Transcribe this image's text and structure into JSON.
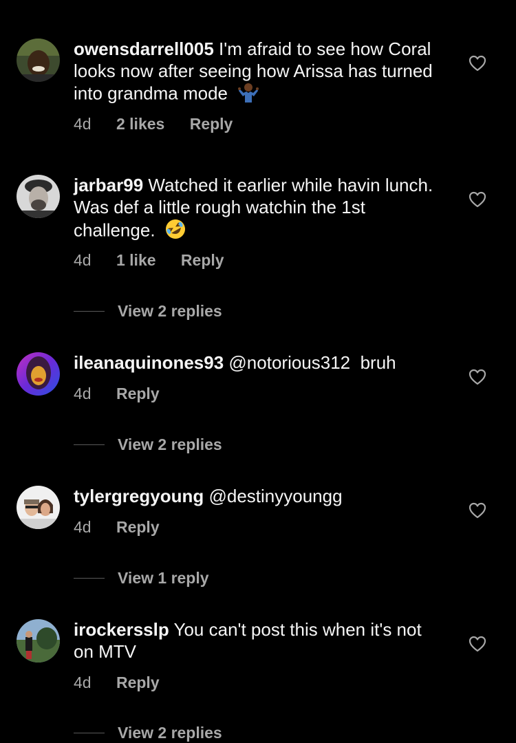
{
  "comments": [
    {
      "username": "owensdarrell005",
      "text": " I'm afraid to see how Coral looks now after seeing how Arissa has turned into grandma mode",
      "emoji": "person-shrugging-emoji",
      "time": "4d",
      "likes": "2 likes",
      "reply": "Reply",
      "view_replies": ""
    },
    {
      "username": "jarbar99",
      "text": " Watched it earlier while havin lunch. Was def a little rough watchin the 1st challenge.",
      "emoji": "rolling-on-floor-laughing-emoji",
      "time": "4d",
      "likes": "1 like",
      "reply": "Reply",
      "view_replies": "View 2 replies"
    },
    {
      "username": "ileanaquinones93",
      "text": " @notorious312  bruh",
      "time": "4d",
      "reply": "Reply",
      "view_replies": "View 2 replies"
    },
    {
      "username": "tylergregyoung",
      "text": " @destinyyoungg",
      "time": "4d",
      "reply": "Reply",
      "view_replies": "View 1 reply"
    },
    {
      "username": "irockersslp",
      "text": " You can't post this when it's not on MTV",
      "time": "4d",
      "reply": "Reply",
      "view_replies": "View 2 replies"
    }
  ],
  "colors": {
    "background": "#000000",
    "primary_text": "#f5f5f5",
    "secondary_text": "#a8a8a8"
  }
}
